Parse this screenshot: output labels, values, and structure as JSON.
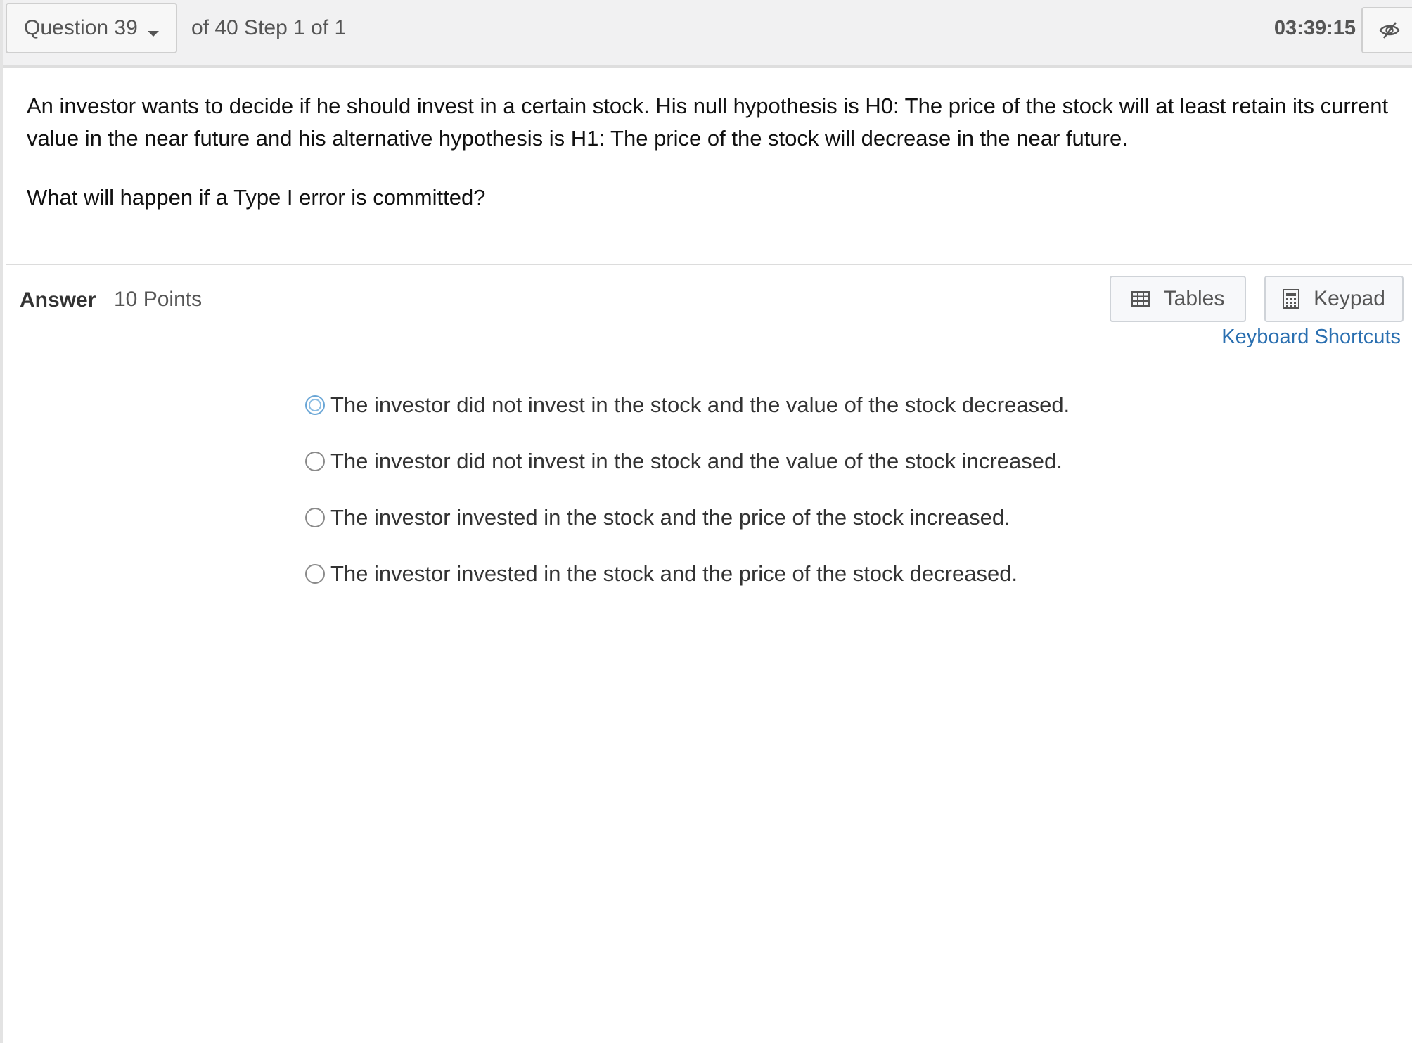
{
  "topbar": {
    "question_select": "Question 39",
    "step_text": "of 40 Step 1 of 1",
    "timer": "03:39:15",
    "hide_icon": "eye-slash-icon"
  },
  "question": {
    "paragraph1": "An investor wants to decide if he should invest in a certain stock.  His null hypothesis is H0: The price of the stock will at least retain its current value in the near future and his alternative hypothesis is H1: The price of the stock will decrease in the near future.",
    "paragraph2": "What will happen if a Type I error is committed?"
  },
  "answer": {
    "label": "Answer",
    "points": "10 Points",
    "tables_label": "Tables",
    "keypad_label": "Keypad",
    "shortcuts_label": "Keyboard Shortcuts",
    "options": [
      {
        "text": "The investor did not invest in the stock and the value of the stock decreased.",
        "selected": false,
        "focused": true
      },
      {
        "text": "The investor did not invest in the stock and the value of the stock increased.",
        "selected": false,
        "focused": false
      },
      {
        "text": "The investor invested in the stock and the price of the stock increased.",
        "selected": false,
        "focused": false
      },
      {
        "text": "The investor invested in the stock and the price of the stock decreased.",
        "selected": false,
        "focused": false
      }
    ]
  },
  "colors": {
    "link": "#2a6fb0",
    "topbar_bg": "#f1f1f2",
    "focus_ring": "#6aa6d6"
  }
}
